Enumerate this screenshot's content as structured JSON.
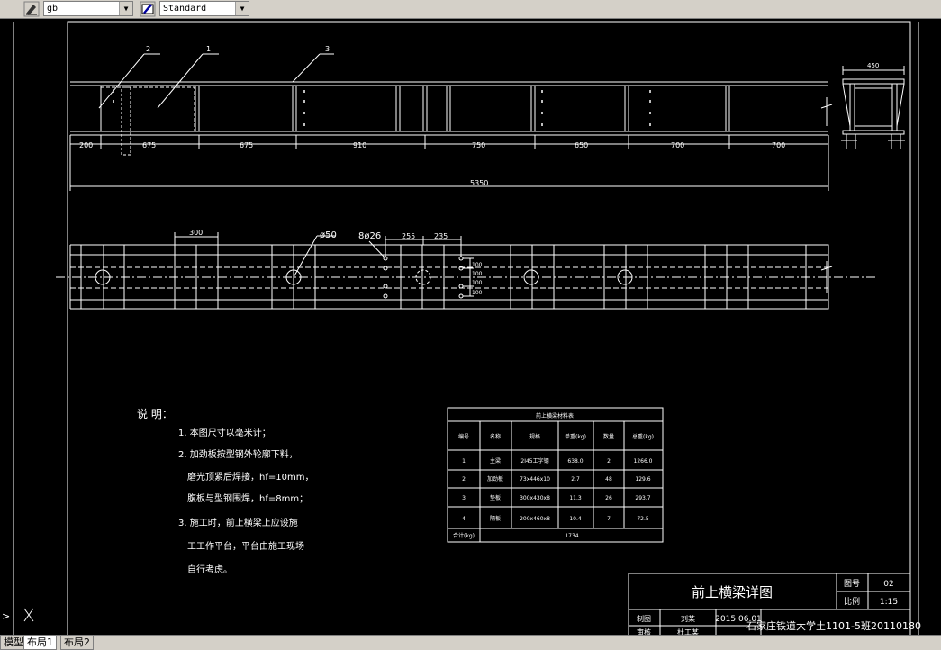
{
  "toolbar": {
    "textstyle_icon": "text-style-icon",
    "textstyle_value": "gb",
    "tablestyle_icon": "table-style-icon",
    "tablestyle_value": "Standard"
  },
  "drawing": {
    "callouts": [
      "2",
      "1",
      "3"
    ],
    "top_dims": [
      "200",
      "675",
      "675",
      "910",
      "750",
      "650",
      "700",
      "700"
    ],
    "total_dim": "5350",
    "side_dim": "450",
    "plan_dims": [
      "300",
      "ø50",
      "8ø26",
      "255",
      "235",
      "100",
      "100",
      "100",
      "100"
    ],
    "notes_title": "说 明：",
    "notes": [
      "1. 本图尺寸以毫米计；",
      "2. 加劲板按型钢外轮廓下料，",
      "磨光顶紧后焊接，hf=10mm，",
      "腹板与型钢围焊，hf=8mm；",
      "3. 施工时，前上横梁上应设施",
      "工工作平台，平台由施工现场",
      "自行考虑。"
    ],
    "table": {
      "title": "前上横梁材料表",
      "headers": [
        "编号",
        "名称",
        "规格",
        "单重(kg)",
        "数量",
        "总重(kg)"
      ],
      "rows": [
        [
          "1",
          "主梁",
          "2I45工字钢",
          "638.0",
          "2",
          "1266.0"
        ],
        [
          "2",
          "加劲板",
          "73x446x10",
          "2.7",
          "48",
          "129.6"
        ],
        [
          "3",
          "垫板",
          "300x430x8",
          "11.3",
          "26",
          "293.7"
        ],
        [
          "4",
          "隔板",
          "200x460x8",
          "10.4",
          "7",
          "72.5"
        ]
      ],
      "total_label": "合计(kg)",
      "total_value": "1734"
    },
    "title_block": {
      "drawing_name": "前上横梁详图",
      "fig_no_label": "图号",
      "fig_no": "02",
      "scale_label": "比例",
      "scale": "1:15",
      "designer_label": "制图",
      "designer": "刘某",
      "date": "2015.06.01",
      "school": "石家庄铁道大学土1101-5班20110180",
      "checker_label": "审核",
      "checker": "杜工某"
    }
  },
  "command": {
    "prompt": ">",
    "axis": "X"
  },
  "tabs": [
    "模型",
    "布局1",
    "布局2"
  ]
}
